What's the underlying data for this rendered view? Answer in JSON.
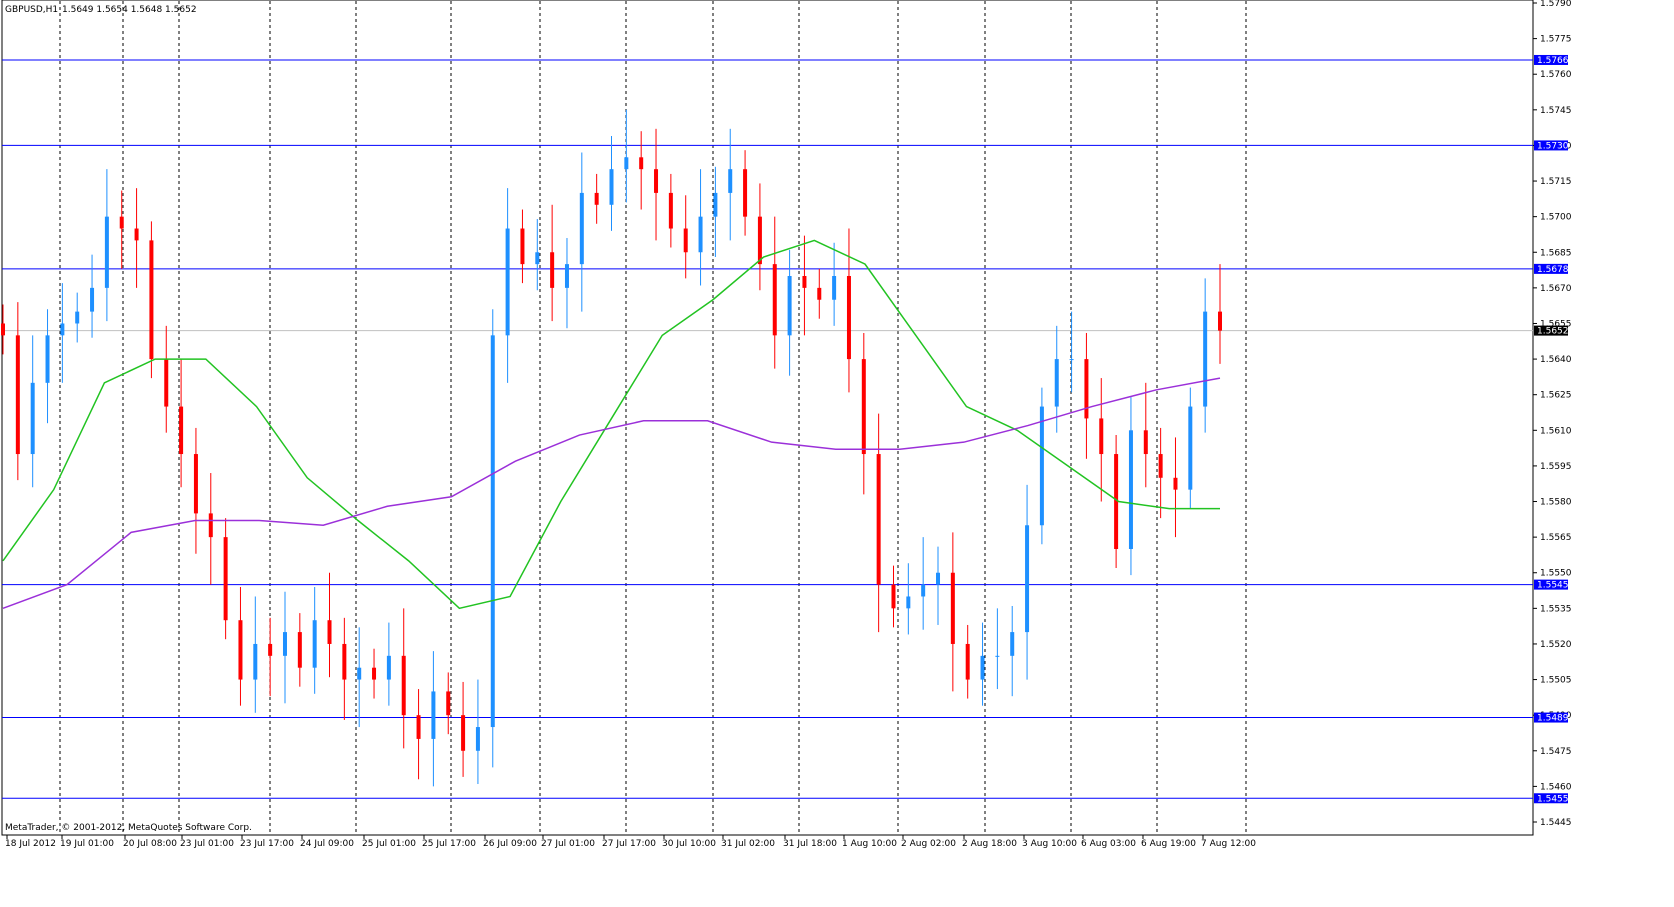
{
  "header": {
    "symbol": "GBPUSD,H1",
    "ohlc": "1.5649 1.5654 1.5648 1.5652"
  },
  "footer": {
    "copyright": "MetaTrader, © 2001-2012, MetaQuotes Software Corp."
  },
  "colors": {
    "bull": "#1E90FF",
    "bear": "#FF0000",
    "ma_fast": "#22C322",
    "ma_slow": "#9B30D9",
    "levels": "#0000FF",
    "bid_line": "#C0C0C0"
  },
  "chart_data": {
    "type": "candlestick",
    "title": "GBPUSD,H1",
    "ylim": [
      1.5445,
      1.579
    ],
    "y_ticks": [
      "1.5790",
      "1.5775",
      "1.5760",
      "1.5745",
      "1.5730",
      "1.5715",
      "1.5700",
      "1.5685",
      "1.5670",
      "1.5655",
      "1.5640",
      "1.5625",
      "1.5610",
      "1.5595",
      "1.5580",
      "1.5565",
      "1.5550",
      "1.5535",
      "1.5520",
      "1.5505",
      "1.5490",
      "1.5475",
      "1.5460",
      "1.5445"
    ],
    "x_ticks": [
      "18 Jul 2012",
      "19 Jul 01:00",
      "20 Jul 08:00",
      "23 Jul 01:00",
      "23 Jul 17:00",
      "24 Jul 09:00",
      "25 Jul 01:00",
      "25 Jul 17:00",
      "26 Jul 09:00",
      "27 Jul 01:00",
      "27 Jul 17:00",
      "30 Jul 10:00",
      "31 Jul 02:00",
      "31 Jul 18:00",
      "1 Aug 10:00",
      "2 Aug 02:00",
      "2 Aug 18:00",
      "3 Aug 10:00",
      "6 Aug 03:00",
      "6 Aug 19:00",
      "7 Aug 12:00"
    ],
    "closes": [
      1.565,
      1.56,
      1.563,
      1.565,
      1.5655,
      1.566,
      1.567,
      1.57,
      1.5695,
      1.569,
      1.564,
      1.562,
      1.56,
      1.5575,
      1.5565,
      1.553,
      1.5505,
      1.552,
      1.5515,
      1.5525,
      1.551,
      1.553,
      1.552,
      1.5505,
      1.551,
      1.5505,
      1.5515,
      1.549,
      1.548,
      1.55,
      1.549,
      1.5475,
      1.5485,
      1.565,
      1.5695,
      1.568,
      1.5685,
      1.567,
      1.568,
      1.571,
      1.5705,
      1.572,
      1.5725,
      1.572,
      1.571,
      1.5695,
      1.5685,
      1.57,
      1.571,
      1.572,
      1.57,
      1.568,
      1.565,
      1.5675,
      1.567,
      1.5665,
      1.5675,
      1.564,
      1.56,
      1.5545,
      1.5535,
      1.554,
      1.5545,
      1.555,
      1.552,
      1.5505,
      1.5515,
      1.5515,
      1.5525,
      1.557,
      1.562,
      1.564,
      1.564,
      1.5615,
      1.56,
      1.556,
      1.561,
      1.56,
      1.559,
      1.5585,
      1.562,
      1.566,
      1.5652
    ],
    "ma_fast": [
      1.5555,
      1.5585,
      1.563,
      1.564,
      1.564,
      1.562,
      1.559,
      1.5572,
      1.5555,
      1.5535,
      1.554,
      1.558,
      1.5615,
      1.565,
      1.5665,
      1.5683,
      1.569,
      1.568,
      1.565,
      1.562,
      1.561,
      1.5595,
      1.558,
      1.5577,
      1.5577
    ],
    "ma_slow": [
      1.5535,
      1.5545,
      1.5567,
      1.5572,
      1.5572,
      1.557,
      1.5578,
      1.5582,
      1.5597,
      1.5608,
      1.5614,
      1.5614,
      1.5605,
      1.5602,
      1.5602,
      1.5605,
      1.5612,
      1.562,
      1.5627,
      1.5632
    ],
    "levels": [
      "1.5766",
      "1.5730",
      "1.5678",
      "1.5545",
      "1.5489",
      "1.5455"
    ],
    "bid": "1.5652"
  }
}
